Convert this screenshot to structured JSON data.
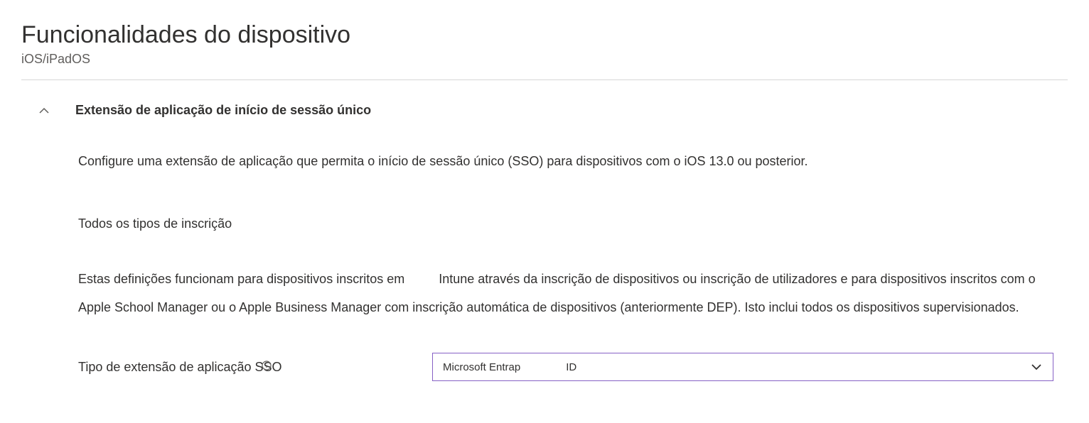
{
  "header": {
    "title": "Funcionalidades do dispositivo",
    "subtitle": "iOS/iPadOS"
  },
  "section": {
    "title": "Extensão de aplicação de início de sessão único",
    "description": "Configure uma extensão de aplicação que permita o início de sessão único (SSO) para dispositivos com o iOS 13.0 ou posterior.",
    "subsection": {
      "title": "Todos os tipos de inscrição",
      "description_part1": "Estas definições funcionam para dispositivos inscritos em",
      "description_part2": "Intune através da inscrição de dispositivos ou inscrição de utilizadores e para dispositivos inscritos com o Apple School Manager ou o Apple Business Manager com inscrição automática de dispositivos (anteriormente DEP). Isto inclui todos os dispositivos supervisionados."
    },
    "form": {
      "sso_type_label": "Tipo de extensão de aplicação SSO",
      "sso_type_value_part1": "Microsoft Entrap",
      "sso_type_value_part2": "ID"
    }
  }
}
